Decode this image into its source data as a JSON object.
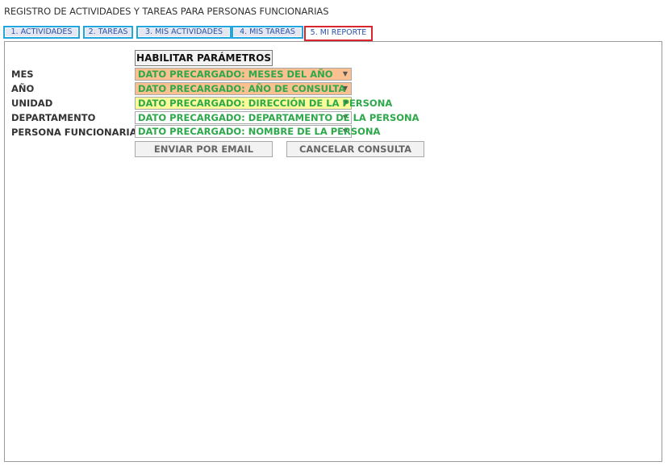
{
  "header": {
    "title": "REGISTRO DE ACTIVIDADES Y TAREAS PARA PERSONAS FUNCIONARIAS"
  },
  "tabs": [
    {
      "label": "1. ACTIVIDADES"
    },
    {
      "label": "2. TAREAS"
    },
    {
      "label": "3. MIS ACTIVIDADES"
    },
    {
      "label": "4. MIS TAREAS"
    },
    {
      "label": "5. MI REPORTE"
    }
  ],
  "form": {
    "enable_button": "HABILITAR PARÁMETROS",
    "fields": [
      {
        "label": "MES",
        "value": "DATO PRECARGADO: MESES DEL AÑO"
      },
      {
        "label": "AÑO",
        "value": "DATO PRECARGADO: AÑO DE CONSULTA"
      },
      {
        "label": "UNIDAD",
        "value": "DATO PRECARGADO: DIRECCIÓN DE LA PERSONA"
      },
      {
        "label": "DEPARTAMENTO",
        "value": "DATO PRECARGADO: DEPARTAMENTO DE LA PERSONA"
      },
      {
        "label": "PERSONA FUNCIONARIA",
        "value": "DATO PRECARGADO: NOMBRE DE LA PERSONA"
      }
    ],
    "dropdown_arrow": "▼",
    "send_email_button": "ENVIAR POR EMAIL",
    "cancel_button": "CANCELAR CONSULTA"
  },
  "colors": {
    "tab_border": "#22a6e0",
    "active_tab_border": "#d9262e",
    "field_text": "#2da84a",
    "mes_bg": "#fbc08f",
    "anio_bg": "#fbc08f",
    "unidad_bg": "#fbfb9a",
    "departamento_bg": "#ffffff",
    "persona_bg": "#ffffff"
  }
}
